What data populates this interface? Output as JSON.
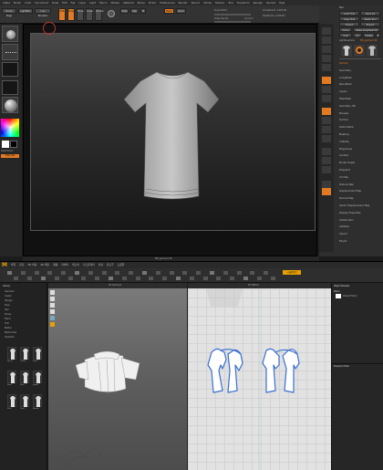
{
  "zbrush": {
    "menu": [
      "Alpha",
      "Brush",
      "Color",
      "Document",
      "Draw",
      "Edit",
      "File",
      "Layer",
      "Light",
      "Macro",
      "Marker",
      "Material",
      "Movie",
      "Picker",
      "Preferences",
      "Render",
      "Stencil",
      "Stroke",
      "Texture",
      "Tool",
      "Transform",
      "Zplugin",
      "Zscript",
      "Help"
    ],
    "shelf": {
      "home_page": "Home Page",
      "lightbox": "LightBox",
      "live_boolean": "Live Boolean",
      "edit": "Edit",
      "draw": "Draw",
      "move": "Move",
      "scale": "Scale",
      "rotate": "Rotate",
      "mrgb": "Mrgb",
      "rgb": "Rgb",
      "m": "M",
      "zadd": "Zadd",
      "zsub": "Zsub",
      "focal_shift_label": "Focal Shift 0",
      "draw_size_label": "Draw Size 64",
      "dynamic": "Dynamic",
      "active_points": "ActivePoints: 4,326 Mil",
      "total_points": "TotalPoints: 4,326 Mil"
    },
    "left": {
      "brush": "Standard",
      "stroke": "Dots",
      "alpha": "Off",
      "texture": "Texture Off",
      "material": "MatCap Gray",
      "gradient": "Gradient",
      "switch_color": "SwitchColor",
      "alternate": "Alternate"
    },
    "right": {
      "title": "Tool",
      "load_tool": "Load Tool",
      "save_as": "Save As",
      "copy_tool": "Copy Tool",
      "paste_tool": "Paste Tool",
      "import": "Import",
      "export": "Export",
      "clone": "Clone",
      "make_polymesh": "Make PolyMesh3D",
      "goz": "GoZ",
      "all": "All",
      "visible": "Visible",
      "r": "R",
      "lightbox_tools": "Lightbox▸Tools",
      "tool_name": "MD_garment 48",
      "subtool": "Subtool",
      "geometry": "Geometry",
      "array_mesh": "ArrayMesh",
      "nanomesh": "NanoMesh",
      "layers": "Layers",
      "fibermesh": "FiberMesh",
      "geometry_hd": "Geometry HD",
      "preview": "Preview",
      "surface": "Surface",
      "deformation": "Deformation",
      "masking": "Masking",
      "visibility": "Visibility",
      "polygroups": "Polygroups",
      "contact": "Contact",
      "morph_target": "Morph Target",
      "polypaint": "Polypaint",
      "uv_map": "UV Map",
      "texture_map": "Texture Map",
      "displacement_map": "Displacement Map",
      "normal_map": "Normal Map",
      "vector_displacement": "Vector Displacement Map",
      "display_properties": "Display Properties",
      "unified_skin": "Unified Skin",
      "initialize": "Initialize",
      "import2": "Import",
      "export2": "Export"
    },
    "footer": "MD_garment 48"
  },
  "md": {
    "logo": "M",
    "menu": [
      "파일",
      "편집",
      "3D 의상",
      "2D 패턴",
      "재봉",
      "아바타",
      "텍스처",
      "디스플레이",
      "설정",
      "윈도우",
      "도움말"
    ],
    "mode_label": "시뮬레이션",
    "library": {
      "title": "Library",
      "items": [
        "Garment",
        "Avatar",
        "Hanger",
        "Pose",
        "Hair",
        "Shoes",
        "Fabric",
        "Trim",
        "Button",
        "Buttonhole",
        "Topstitch"
      ],
      "thumbs": [
        "Dress",
        "T-Shirt",
        "Pants",
        "Shirt",
        "Skirt",
        "Jacket",
        "Vest",
        "Coat",
        "Blouse"
      ]
    },
    "panels": {
      "view3d": "3D Garment",
      "view2d": "2D Pattern",
      "object_browser": "Object Browser",
      "fabric": "Fabric",
      "default_fabric": "Default Fabric",
      "property_editor": "Property Editor"
    }
  },
  "colors": {
    "accent": "#e17a22",
    "md_pattern_stroke": "#3a6fd0",
    "md_pattern_fill": "#ffffff"
  }
}
